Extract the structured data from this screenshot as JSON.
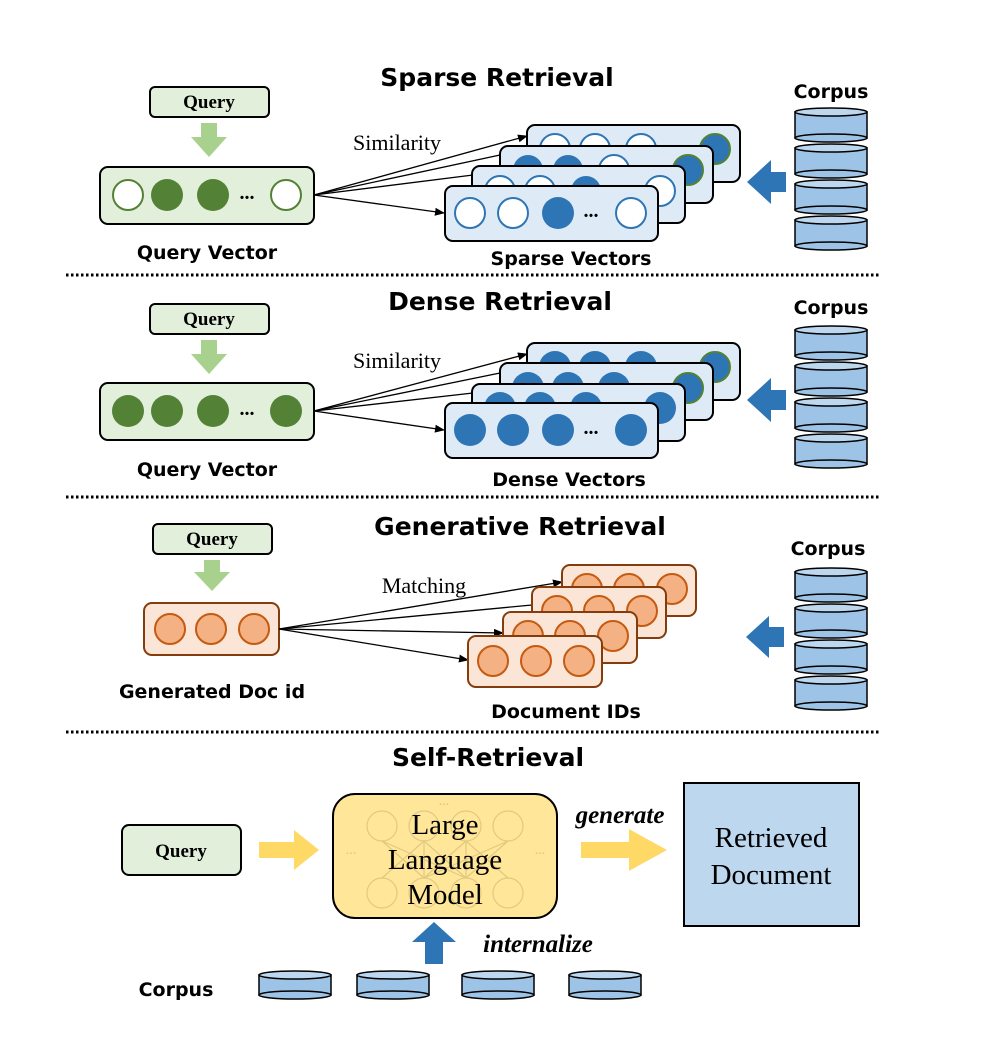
{
  "colors": {
    "green_fill": "#e2efda",
    "green_dark": "#538135",
    "green_arrow": "#a9d18e",
    "blue_fill": "#deebf7",
    "blue_dark": "#2e75b6",
    "db_fill": "#9dc3e6",
    "db_top": "#bdd7ee",
    "orange_fill": "#fbe5d6",
    "orange_dot": "#f4b183",
    "orange_stroke": "#c55a11",
    "orange_border": "#843c0c",
    "llm_fill": "#ffe699",
    "yellow_arrow": "#ffd966",
    "doc_fill": "#bdd7ee"
  },
  "sections": [
    {
      "id": "sparse",
      "title": "Sparse Retrieval",
      "query_label": "Query",
      "query_vector_label": "Query Vector",
      "query_vector_pattern": [
        "empty",
        "filled",
        "filled",
        "ellipsis",
        "empty"
      ],
      "edge_label": "Similarity",
      "doc_vectors_label": "Sparse Vectors",
      "corpus_label": "Corpus",
      "front_vector_pattern": [
        "empty",
        "empty",
        "filled",
        "ellipsis",
        "empty"
      ]
    },
    {
      "id": "dense",
      "title": "Dense Retrieval",
      "query_label": "Query",
      "query_vector_label": "Query Vector",
      "query_vector_pattern": [
        "filled",
        "filled",
        "filled",
        "ellipsis",
        "filled"
      ],
      "edge_label": "Similarity",
      "doc_vectors_label": "Dense Vectors",
      "corpus_label": "Corpus",
      "front_vector_pattern": [
        "filled",
        "filled",
        "filled",
        "ellipsis",
        "filled"
      ]
    },
    {
      "id": "generative",
      "title": "Generative Retrieval",
      "query_label": "Query",
      "query_vector_label": "Generated Doc id",
      "edge_label": "Matching",
      "doc_vectors_label": "Document IDs",
      "corpus_label": "Corpus"
    },
    {
      "id": "self",
      "title": "Self-Retrieval",
      "query_label": "Query",
      "model_lines": [
        "Large",
        "Language",
        "Model"
      ],
      "generate_label": "generate",
      "output_lines": [
        "Retrieved",
        "Document"
      ],
      "internalize_label": "internalize",
      "corpus_label": "Corpus"
    }
  ],
  "ellipsis": "..."
}
